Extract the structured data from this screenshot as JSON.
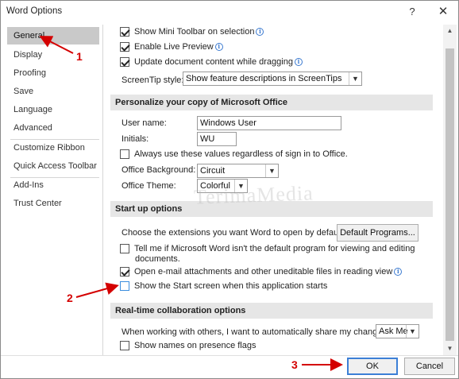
{
  "window": {
    "title": "Word Options",
    "help_label": "?",
    "close_label": "✕"
  },
  "sidebar": {
    "items": [
      {
        "label": "General",
        "selected": true
      },
      {
        "label": "Display"
      },
      {
        "label": "Proofing"
      },
      {
        "label": "Save"
      },
      {
        "label": "Language"
      },
      {
        "label": "Advanced"
      },
      {
        "label": "Customize Ribbon"
      },
      {
        "label": "Quick Access Toolbar"
      },
      {
        "label": "Add-Ins"
      },
      {
        "label": "Trust Center"
      }
    ]
  },
  "ui_options": {
    "mini_toolbar": {
      "label": "Show Mini Toolbar on selection",
      "checked": true
    },
    "live_preview": {
      "label": "Enable Live Preview",
      "checked": true
    },
    "update_dragging": {
      "label": "Update document content while dragging",
      "checked": true
    },
    "screentip_label": "ScreenTip style:",
    "screentip_value": "Show feature descriptions in ScreenTips"
  },
  "personalize": {
    "heading": "Personalize your copy of Microsoft Office",
    "username_label": "User name:",
    "username_value": "Windows User",
    "initials_label": "Initials:",
    "initials_value": "WU",
    "always_use": {
      "label": "Always use these values regardless of sign in to Office.",
      "checked": false
    },
    "background_label": "Office Background:",
    "background_value": "Circuit",
    "theme_label": "Office Theme:",
    "theme_value": "Colorful"
  },
  "startup": {
    "heading": "Start up options",
    "extensions_label": "Choose the extensions you want Word to open by default:",
    "default_programs_button": "Default Programs...",
    "tell_me": {
      "label_line1": "Tell me if Microsoft Word isn't the default program for viewing and editing",
      "label_line2": "documents.",
      "checked": false
    },
    "open_attachments": {
      "label": "Open e-mail attachments and other uneditable files in reading view",
      "checked": true
    },
    "show_start": {
      "label": "Show the Start screen when this application starts",
      "checked": false
    }
  },
  "collab": {
    "heading": "Real-time collaboration options",
    "share_label": "When working with others, I want to automatically share my changes:",
    "share_value": "Ask Me",
    "presence_flags": {
      "label": "Show names on presence flags",
      "checked": false
    }
  },
  "footer": {
    "ok_label": "OK",
    "cancel_label": "Cancel"
  },
  "annotations": {
    "a1": "1",
    "a2": "2",
    "a3": "3"
  },
  "watermark": "TerimaMedia",
  "colors": {
    "annotation": "#d40000",
    "selected_nav": "#c9c9c9",
    "section_bg": "#e6e6e6",
    "focus_blue": "#3c7fd6"
  }
}
